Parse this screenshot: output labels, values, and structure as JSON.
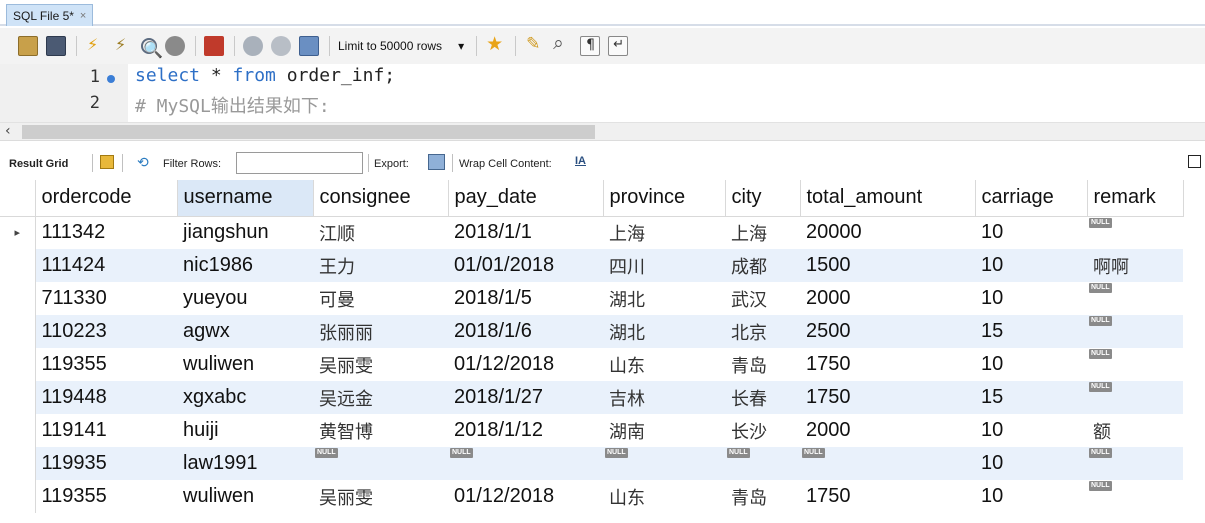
{
  "tab": {
    "title": "SQL File 5*",
    "close": "×"
  },
  "toolbar": {
    "icons": [
      "open-folder-icon",
      "save-icon",
      "execute-icon",
      "execute-current-icon",
      "explain-icon",
      "stop-icon",
      "toggle-error-icon",
      "commit-icon",
      "rollback-icon",
      "autocommit-icon",
      "beautify-icon",
      "find-icon",
      "invisible-chars-icon",
      "wrap-icon"
    ],
    "limit_label": "Limit to 50000 rows",
    "limit_arrow": "▾"
  },
  "editor": {
    "lines": [
      {
        "number": "1",
        "keyword1": "select",
        "mid": " * ",
        "keyword2": "from",
        "rest": " order_inf;"
      },
      {
        "number": "2",
        "comment": "# MySQL输出结果如下:"
      }
    ]
  },
  "scroll": {
    "arrow": "‹"
  },
  "result_toolbar": {
    "result_grid": "Result Grid",
    "filter_rows": "Filter Rows:",
    "export": "Export:",
    "wrap_cell": "Wrap Cell Content:",
    "wrap_glyph": "IA"
  },
  "grid": {
    "row_marker": "▸",
    "null_label": "NULL",
    "columns": [
      "ordercode",
      "username",
      "consignee",
      "pay_date",
      "province",
      "city",
      "total_amount",
      "carriage",
      "remark"
    ],
    "rows": [
      [
        "111342",
        "jiangshun",
        "江顺",
        "2018/1/1",
        "上海",
        "上海",
        "20000",
        "10",
        null
      ],
      [
        "111424",
        "nic1986",
        "王力",
        "01/01/2018",
        "四川",
        "成都",
        "1500",
        "10",
        "啊啊"
      ],
      [
        "711330",
        "yueyou",
        "可曼",
        "2018/1/5",
        "湖北",
        "武汉",
        "2000",
        "10",
        null
      ],
      [
        "110223",
        "agwx",
        "张丽丽",
        "2018/1/6",
        "湖北",
        "北京",
        "2500",
        "15",
        null
      ],
      [
        "119355",
        "wuliwen",
        "吴丽雯",
        "01/12/2018",
        "山东",
        "青岛",
        "1750",
        "10",
        null
      ],
      [
        "119448",
        "xgxabc",
        "吴远金",
        "2018/1/27",
        "吉林",
        "长春",
        "1750",
        "15",
        null
      ],
      [
        "119141",
        "huiji",
        "黄智博",
        "2018/1/12",
        "湖南",
        "长沙",
        "2000",
        "10",
        "额"
      ],
      [
        "119935",
        "law1991",
        null,
        null,
        null,
        null,
        null,
        "10",
        null
      ],
      [
        "119355",
        "wuliwen",
        "吴丽雯",
        "01/12/2018",
        "山东",
        "青岛",
        "1750",
        "10",
        null
      ]
    ]
  },
  "colors": {
    "accent": "#2d6fc6",
    "alt_row": "#e9f1fb",
    "sorted_header": "#dbe8f7"
  }
}
